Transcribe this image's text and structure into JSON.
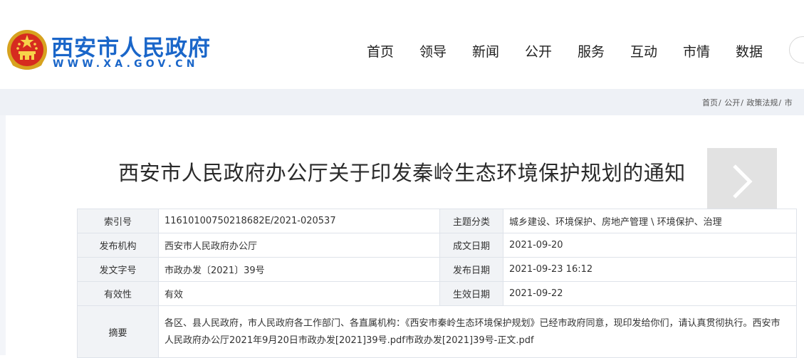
{
  "header": {
    "site_name": "西安市人民政府",
    "site_url": "WWW.XA.GOV.CN",
    "emblem_icon": "national-emblem-icon",
    "nav": [
      "首页",
      "领导",
      "新闻",
      "公开",
      "服务",
      "互动",
      "市情",
      "数据"
    ]
  },
  "breadcrumb": [
    "首页",
    "公开",
    "政策法规",
    "市"
  ],
  "document": {
    "title": "西安市人民政府办公厅关于印发秦岭生态环境保护规划的通知",
    "next_icon": "chevron-right-icon"
  },
  "info": {
    "index_no_label": "索引号",
    "index_no": "11610100750218682E/2021-020537",
    "topic_label": "主题分类",
    "topic": "城乡建设、环境保护、房地产管理 \\ 环境保护、治理",
    "issuer_label": "发布机构",
    "issuer": "西安市人民政府办公厅",
    "created_label": "成文日期",
    "created": "2021-09-20",
    "doc_no_label": "发文字号",
    "doc_no": "市政办发〔2021〕39号",
    "published_label": "发布日期",
    "published": "2021-09-23 16:12",
    "validity_label": "有效性",
    "validity": "有效",
    "effective_label": "生效日期",
    "effective": "2021-09-22",
    "abstract_label": "摘要",
    "abstract": "各区、县人民政府，市人民政府各工作部门、各直属机构：《西安市秦岭生态环境保护规划》已经市政府同意，现印发给你们，请认真贯彻执行。西安市人民政府办公厅2021年9月20日市政办发[2021]39号.pdf市政办发[2021]39号-正文.pdf"
  },
  "colors": {
    "brand_blue": "#1a66c9",
    "strip_bg": "#eef1f6",
    "label_bg": "#f1f3f6"
  }
}
